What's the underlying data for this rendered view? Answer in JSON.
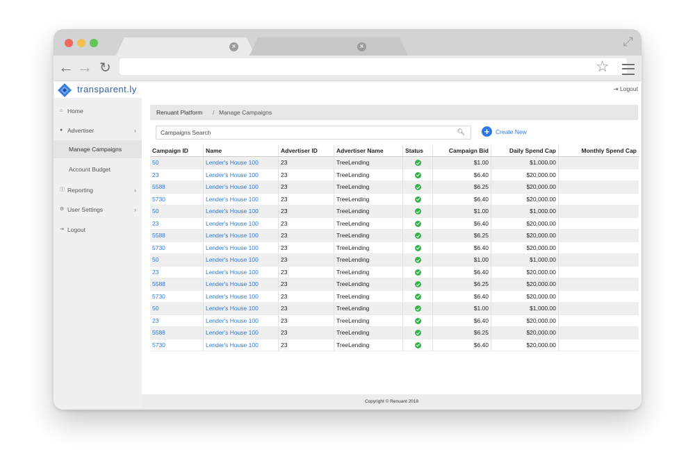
{
  "app": {
    "logo_text": "transparent.ly",
    "logout_label": "Logout"
  },
  "sidebar": {
    "items": [
      {
        "label": "Home",
        "icon": "home-icon"
      },
      {
        "label": "Advertiser",
        "icon": "circle-icon",
        "chevron": "›"
      },
      {
        "label": "Manage Campaigns",
        "active": true
      },
      {
        "label": "Account Budget"
      },
      {
        "label": "Reporting",
        "icon": "info-icon",
        "chevron": "›"
      },
      {
        "label": "User Settings",
        "icon": "gear-icon",
        "chevron": "›"
      },
      {
        "label": "Logout",
        "icon": "logout-icon"
      }
    ]
  },
  "breadcrumb": {
    "root": "Renuant Platform",
    "separator": "/",
    "current": "Manage Campaigns"
  },
  "search": {
    "placeholder": "Campaigns Search"
  },
  "create_button": {
    "label": "Create New",
    "color": "#2a7ae2"
  },
  "table": {
    "headers": [
      "Campaign ID",
      "Name",
      "Advertiser ID",
      "Advertiser Name",
      "Status",
      "Campaign Bid",
      "Daily Spend Cap",
      "Monthly Spend Cap"
    ],
    "rows": [
      {
        "id": "50",
        "name": "Lender's House 100",
        "adv_id": "23",
        "adv_name": "TreeLending",
        "status": "active",
        "bid": "$1.00",
        "daily": "$1,000.00",
        "monthly": ""
      },
      {
        "id": "23",
        "name": "Lender's House 100",
        "adv_id": "23",
        "adv_name": "TreeLending",
        "status": "active",
        "bid": "$6.40",
        "daily": "$20,000.00",
        "monthly": ""
      },
      {
        "id": "5588",
        "name": "Lender's House 100",
        "adv_id": "23",
        "adv_name": "TreeLending",
        "status": "active",
        "bid": "$6.25",
        "daily": "$20,000.00",
        "monthly": ""
      },
      {
        "id": "5730",
        "name": "Lender's House 100",
        "adv_id": "23",
        "adv_name": "TreeLending",
        "status": "active",
        "bid": "$6.40",
        "daily": "$20,000.00",
        "monthly": ""
      },
      {
        "id": "50",
        "name": "Lender's House 100",
        "adv_id": "23",
        "adv_name": "TreeLending",
        "status": "active",
        "bid": "$1.00",
        "daily": "$1,000.00",
        "monthly": ""
      },
      {
        "id": "23",
        "name": "Lender's House 100",
        "adv_id": "23",
        "adv_name": "TreeLending",
        "status": "active",
        "bid": "$6.40",
        "daily": "$20,000.00",
        "monthly": ""
      },
      {
        "id": "5588",
        "name": "Lender's House 100",
        "adv_id": "23",
        "adv_name": "TreeLending",
        "status": "active",
        "bid": "$6.25",
        "daily": "$20,000.00",
        "monthly": ""
      },
      {
        "id": "5730",
        "name": "Lender's House 100",
        "adv_id": "23",
        "adv_name": "TreeLending",
        "status": "active",
        "bid": "$6.40",
        "daily": "$20,000.00",
        "monthly": ""
      },
      {
        "id": "50",
        "name": "Lender's House 100",
        "adv_id": "23",
        "adv_name": "TreeLending",
        "status": "active",
        "bid": "$1.00",
        "daily": "$1,000.00",
        "monthly": ""
      },
      {
        "id": "23",
        "name": "Lender's House 100",
        "adv_id": "23",
        "adv_name": "TreeLending",
        "status": "active",
        "bid": "$6.40",
        "daily": "$20,000.00",
        "monthly": ""
      },
      {
        "id": "5588",
        "name": "Lender's House 100",
        "adv_id": "23",
        "adv_name": "TreeLending",
        "status": "active",
        "bid": "$6.25",
        "daily": "$20,000.00",
        "monthly": ""
      },
      {
        "id": "5730",
        "name": "Lender's House 100",
        "adv_id": "23",
        "adv_name": "TreeLending",
        "status": "active",
        "bid": "$6.40",
        "daily": "$20,000.00",
        "monthly": ""
      },
      {
        "id": "50",
        "name": "Lender's House 100",
        "adv_id": "23",
        "adv_name": "TreeLending",
        "status": "active",
        "bid": "$1.00",
        "daily": "$1,000.00",
        "monthly": ""
      },
      {
        "id": "23",
        "name": "Lender's House 100",
        "adv_id": "23",
        "adv_name": "TreeLending",
        "status": "active",
        "bid": "$6.40",
        "daily": "$20,000.00",
        "monthly": ""
      },
      {
        "id": "5588",
        "name": "Lender's House 100",
        "adv_id": "23",
        "adv_name": "TreeLending",
        "status": "active",
        "bid": "$6.25",
        "daily": "$20,000.00",
        "monthly": ""
      },
      {
        "id": "5730",
        "name": "Lender's House 100",
        "adv_id": "23",
        "adv_name": "TreeLending",
        "status": "active",
        "bid": "$6.40",
        "daily": "$20,000.00",
        "monthly": ""
      }
    ]
  },
  "footer": {
    "text": "Copyright © Renuant 2018"
  },
  "colors": {
    "link": "#2a7ae2",
    "status_active": "#36b24a",
    "logo": "#2f5fa3"
  }
}
